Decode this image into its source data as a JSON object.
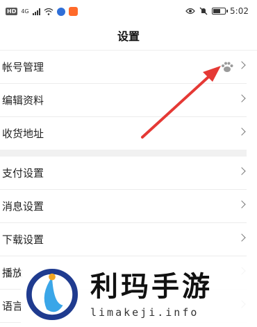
{
  "status_bar": {
    "left_badge": "HD",
    "network": "4G",
    "time": "5:02",
    "icons": [
      "hd-icon",
      "signal-icon",
      "wifi-icon",
      "app-icon",
      "app-icon",
      "eye-icon",
      "mute-icon",
      "battery-icon"
    ]
  },
  "header": {
    "title": "设置"
  },
  "section1": [
    {
      "label": "帐号管理",
      "has_badge": true
    },
    {
      "label": "编辑资料"
    },
    {
      "label": "收货地址"
    }
  ],
  "section2": [
    {
      "label": "支付设置"
    },
    {
      "label": "消息设置"
    },
    {
      "label": "下载设置"
    },
    {
      "label": "播放"
    },
    {
      "label": "语言"
    }
  ],
  "watermark": {
    "title": "利玛手游",
    "url": "limakeji.info"
  },
  "colors": {
    "annotation_arrow": "#e53935",
    "divider": "#ececec",
    "section_gap": "#f1f1f1"
  }
}
